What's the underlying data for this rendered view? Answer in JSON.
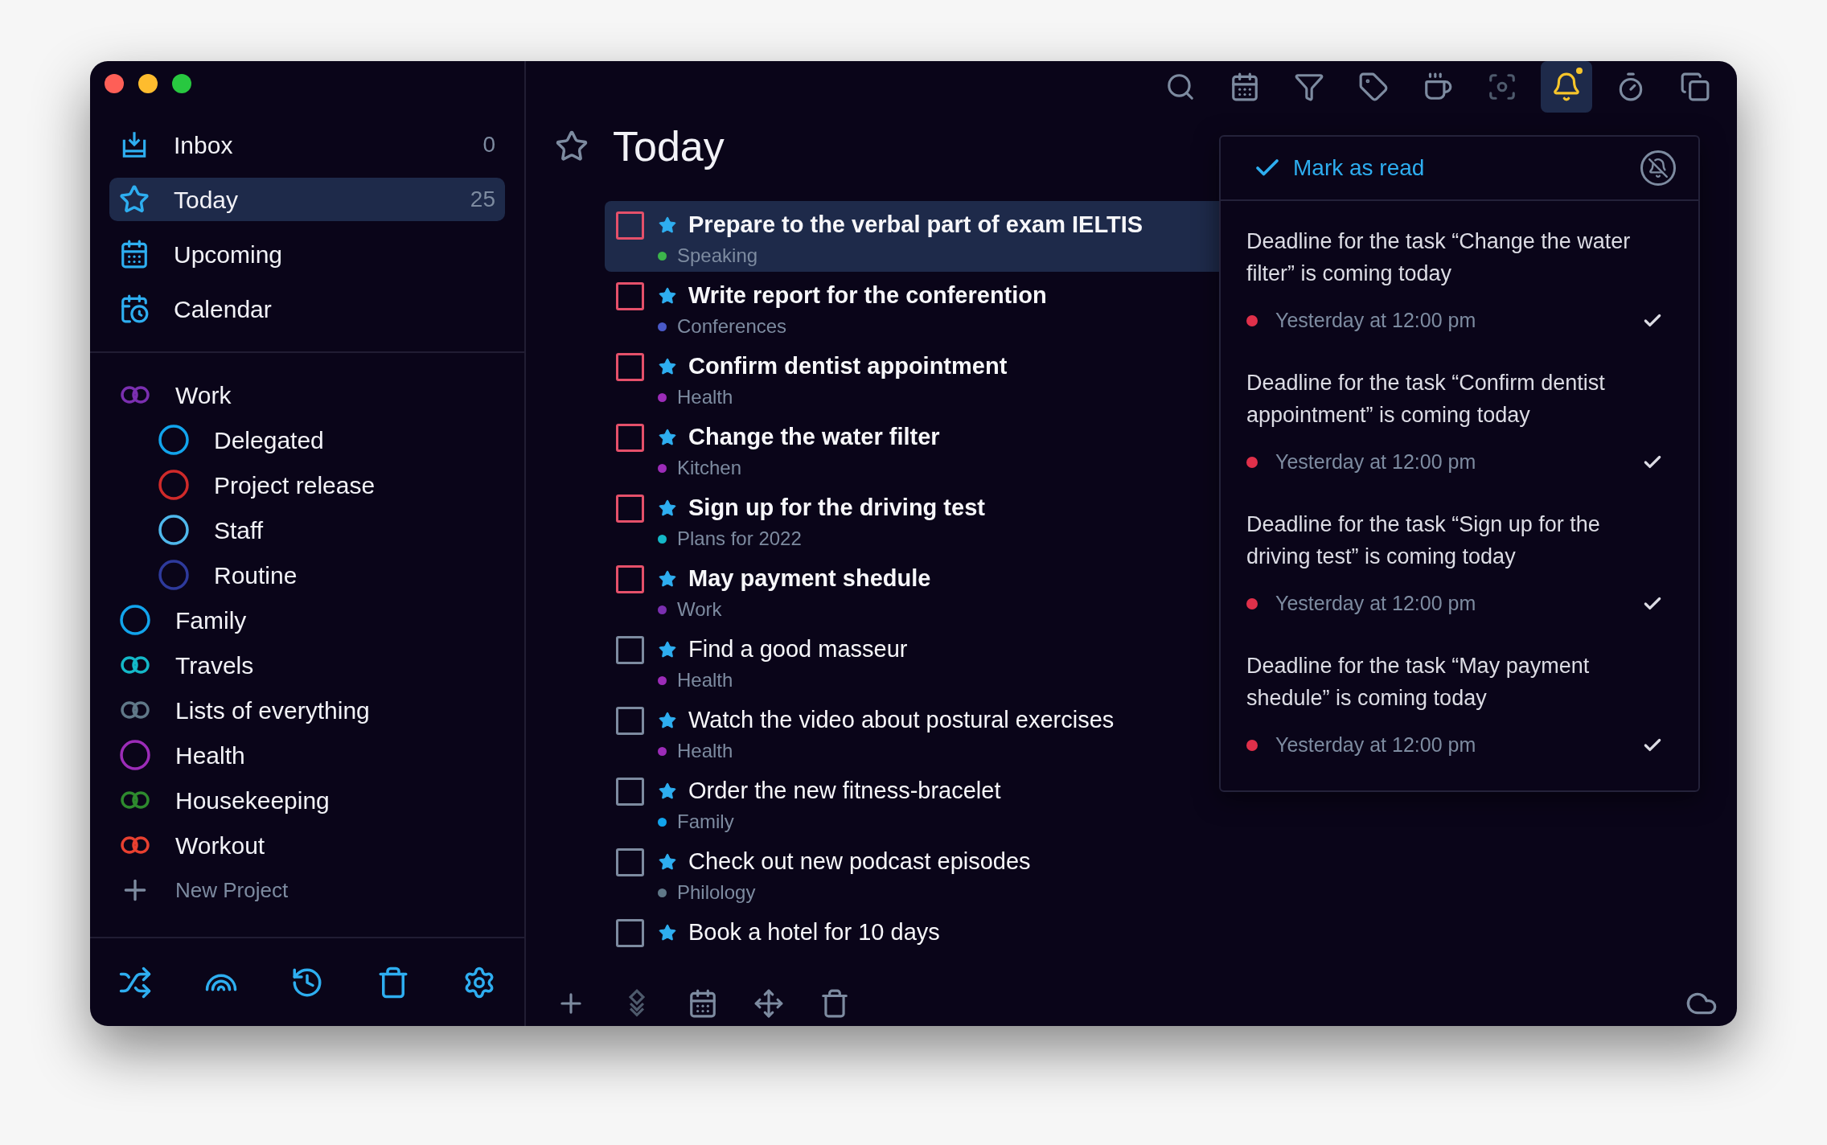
{
  "nav": [
    {
      "kind": "inbox",
      "label": "Inbox",
      "count": "0",
      "selected": false
    },
    {
      "kind": "today",
      "label": "Today",
      "count": "25",
      "selected": true
    },
    {
      "kind": "upcoming",
      "label": "Upcoming",
      "selected": false
    },
    {
      "kind": "calendar",
      "label": "Calendar",
      "selected": false
    }
  ],
  "projects": [
    {
      "kind": "folder",
      "label": "Work",
      "color": "#7b2fb0",
      "children": [
        {
          "kind": "project",
          "label": "Delegated",
          "color": "#12a4ec"
        },
        {
          "kind": "project",
          "label": "Project release",
          "color": "#d02a2a"
        },
        {
          "kind": "project",
          "label": "Staff",
          "color": "#4fb8ec"
        },
        {
          "kind": "project",
          "label": "Routine",
          "color": "#2e3a9c"
        }
      ]
    },
    {
      "kind": "project",
      "label": "Family",
      "color": "#12a4ec"
    },
    {
      "kind": "folder",
      "label": "Travels",
      "color": "#14b8c8"
    },
    {
      "kind": "folder",
      "label": "Lists of everything",
      "color": "#607888"
    },
    {
      "kind": "project",
      "label": "Health",
      "color": "#9c2cb8"
    },
    {
      "kind": "folder",
      "label": "Housekeeping",
      "color": "#2e8a2e"
    },
    {
      "kind": "folder",
      "label": "Workout",
      "color": "#e84030"
    }
  ],
  "new_project": "New Project",
  "sidebar_tools": [
    {
      "kind": "shuffle"
    },
    {
      "kind": "rainbow"
    },
    {
      "kind": "history"
    },
    {
      "kind": "trash"
    },
    {
      "kind": "settings"
    }
  ],
  "toolbar": [
    {
      "kind": "search",
      "selected": false,
      "disabled": false,
      "badge": false
    },
    {
      "kind": "calendar",
      "selected": false,
      "disabled": false,
      "badge": false
    },
    {
      "kind": "filter",
      "selected": false,
      "disabled": false,
      "badge": false
    },
    {
      "kind": "tag",
      "selected": false,
      "disabled": false,
      "badge": false
    },
    {
      "kind": "cup",
      "selected": false,
      "disabled": false,
      "badge": false
    },
    {
      "kind": "focus",
      "selected": false,
      "disabled": true,
      "badge": false
    },
    {
      "kind": "bell",
      "selected": true,
      "disabled": false,
      "badge": true
    },
    {
      "kind": "timer",
      "selected": false,
      "disabled": false,
      "badge": false
    },
    {
      "kind": "copy",
      "selected": false,
      "disabled": false,
      "badge": false
    }
  ],
  "title": "Today",
  "tasks": [
    {
      "title": "Prepare to the verbal part of exam IELTIS",
      "project": "Speaking",
      "color": "#3cb44b",
      "overdue": true,
      "selected": true
    },
    {
      "title": "Write report for the conferention",
      "project": "Conferences",
      "color": "#4a5ac8",
      "overdue": true,
      "selected": false
    },
    {
      "title": "Confirm dentist appointment",
      "project": "Health",
      "color": "#9c2cb8",
      "overdue": true,
      "selected": false
    },
    {
      "title": "Change the water filter",
      "project": "Kitchen",
      "color": "#9c2cb8",
      "overdue": true,
      "selected": false
    },
    {
      "title": "Sign up for the driving test",
      "project": "Plans for 2022",
      "color": "#14b8c8",
      "overdue": true,
      "selected": false
    },
    {
      "title": "May payment shedule",
      "project": "Work",
      "color": "#7b2fb0",
      "overdue": true,
      "selected": false
    },
    {
      "title": "Find a good masseur",
      "project": "Health",
      "color": "#9c2cb8",
      "overdue": false,
      "selected": false
    },
    {
      "title": "Watch the video about postural exercises",
      "project": "Health",
      "color": "#9c2cb8",
      "overdue": false,
      "selected": false
    },
    {
      "title": "Order the new fitness-bracelet",
      "project": "Family",
      "color": "#12a4ec",
      "overdue": false,
      "selected": false
    },
    {
      "title": "Check out new podcast episodes",
      "project": "Philology",
      "color": "#607888",
      "overdue": false,
      "selected": false
    },
    {
      "title": "Book a hotel for 10 days",
      "overdue": false,
      "selected": false
    }
  ],
  "bottom_tools": [
    {
      "kind": "add",
      "disabled": false
    },
    {
      "kind": "layers",
      "disabled": true
    },
    {
      "kind": "calendar",
      "disabled": false
    },
    {
      "kind": "move",
      "disabled": false
    },
    {
      "kind": "trash",
      "disabled": false
    }
  ],
  "notifications": {
    "mark_read": "Mark as read",
    "items": [
      {
        "text": "Deadline for the task “Change the water filter” is coming today",
        "time": "Yesterday at 12:00 pm"
      },
      {
        "text": "Deadline for the task “Confirm dentist appointment” is coming today",
        "time": "Yesterday at 12:00 pm"
      },
      {
        "text": "Deadline for the task “Sign up for the driving test” is coming today",
        "time": "Yesterday at 12:00 pm"
      },
      {
        "text": "Deadline for the task “May payment shedule” is coming today",
        "time": "Yesterday at 12:00 pm"
      }
    ]
  }
}
